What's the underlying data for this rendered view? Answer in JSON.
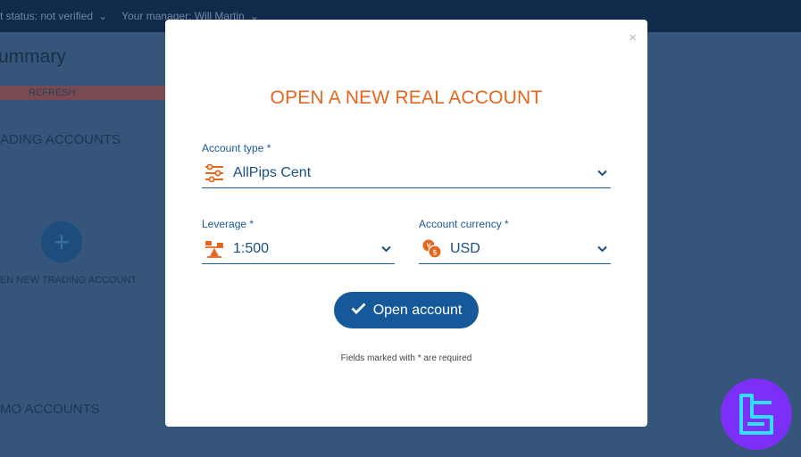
{
  "background": {
    "topbar": {
      "status_text": "t status: not verified",
      "manager_text": "Your manager: Will Martin"
    },
    "page_title": "ummary",
    "refresh_label": "REFRESH",
    "trading_accounts_heading": "ADING ACCOUNTS",
    "add_account_label": "EN NEW TRADING ACCOUNT",
    "demo_accounts_heading": "MO ACCOUNTS"
  },
  "modal": {
    "title": "OPEN A NEW REAL ACCOUNT",
    "close_glyph": "×",
    "account_type": {
      "label": "Account type *",
      "value": "AllPips Cent"
    },
    "leverage": {
      "label": "Leverage *",
      "value": "1:500"
    },
    "currency": {
      "label": "Account currency *",
      "value": "USD"
    },
    "open_button": "Open account",
    "required_note": "Fields marked with * are required"
  },
  "colors": {
    "accent_orange": "#e5661e",
    "primary_blue": "#15599a",
    "logo_purple": "#7b2ff7"
  }
}
